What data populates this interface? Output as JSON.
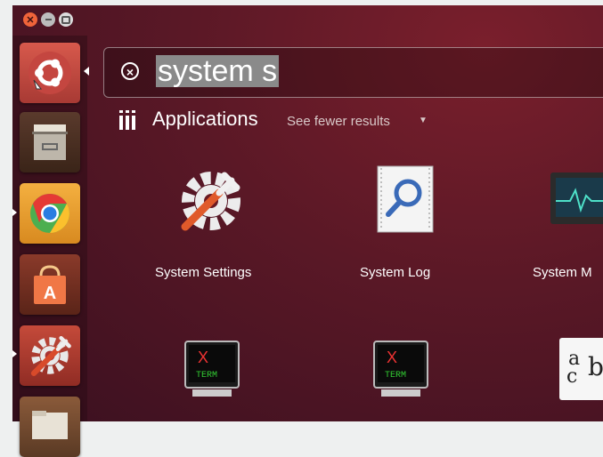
{
  "search": {
    "query": "system s"
  },
  "category": {
    "title": "Applications",
    "filter_label": "See fewer results"
  },
  "results": [
    {
      "label": "System Settings",
      "icon": "system-settings-icon"
    },
    {
      "label": "System Log",
      "icon": "system-log-icon"
    },
    {
      "label": "System M",
      "icon": "system-monitor-icon"
    },
    {
      "label": "",
      "icon": "xterm-icon"
    },
    {
      "label": "",
      "icon": "xterm-icon"
    },
    {
      "label": "",
      "icon": "character-map-icon"
    }
  ],
  "xterm_text": {
    "top": "X",
    "bottom": "TERM"
  },
  "charmap_text": {
    "big": "a",
    "small": "c",
    "extra": "b"
  },
  "launcher": [
    {
      "name": "dash-home",
      "icon": "ubuntu-logo-icon"
    },
    {
      "name": "files",
      "icon": "file-cabinet-icon"
    },
    {
      "name": "chromium",
      "icon": "chrome-icon"
    },
    {
      "name": "software-center",
      "icon": "shopping-bag-icon"
    },
    {
      "name": "system-settings",
      "icon": "system-settings-icon"
    },
    {
      "name": "folder",
      "icon": "folder-icon"
    }
  ],
  "colors": {
    "accent": "#f07746",
    "background": "#5a1826"
  }
}
